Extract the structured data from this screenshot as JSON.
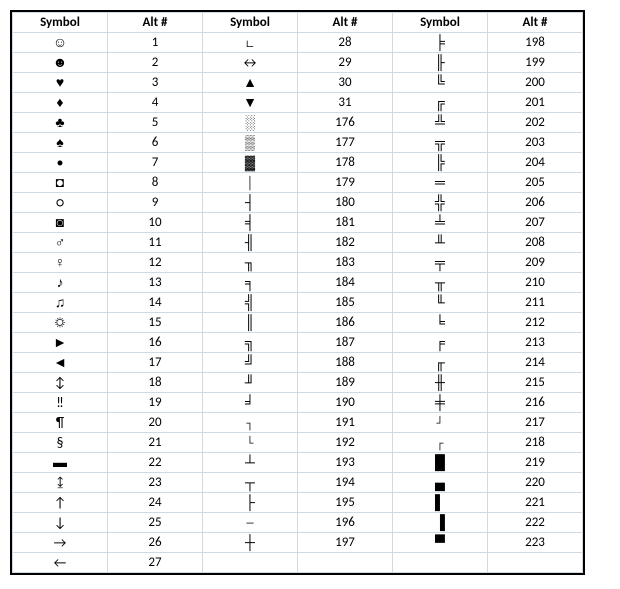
{
  "headers": [
    "Symbol",
    "Alt #",
    "Symbol",
    "Alt #",
    "Symbol",
    "Alt #"
  ],
  "chart_data": {
    "type": "table",
    "title": "Alt Code Symbol Reference",
    "columns": [
      "Symbol",
      "Alt #",
      "Symbol",
      "Alt #",
      "Symbol",
      "Alt #"
    ],
    "rows": [
      [
        "☺",
        "1",
        "∟",
        "28",
        "╞",
        "198"
      ],
      [
        "☻",
        "2",
        "↔",
        "29",
        "╟",
        "199"
      ],
      [
        "♥",
        "3",
        "▲",
        "30",
        "╚",
        "200"
      ],
      [
        "♦",
        "4",
        "▼",
        "31",
        "╔",
        "201"
      ],
      [
        "♣",
        "5",
        "░",
        "176",
        "╩",
        "202"
      ],
      [
        "♠",
        "6",
        "▒",
        "177",
        "╦",
        "203"
      ],
      [
        "•",
        "7",
        "▓",
        "178",
        "╠",
        "204"
      ],
      [
        "◘",
        "8",
        "│",
        "179",
        "═",
        "205"
      ],
      [
        "○",
        "9",
        "┤",
        "180",
        "╬",
        "206"
      ],
      [
        "◙",
        "10",
        "╡",
        "181",
        "╧",
        "207"
      ],
      [
        "♂",
        "11",
        "╢",
        "182",
        "╨",
        "208"
      ],
      [
        "♀",
        "12",
        "╖",
        "183",
        "╤",
        "209"
      ],
      [
        "♪",
        "13",
        "╕",
        "184",
        "╥",
        "210"
      ],
      [
        "♫",
        "14",
        "╣",
        "185",
        "╙",
        "211"
      ],
      [
        "☼",
        "15",
        "║",
        "186",
        "╘",
        "212"
      ],
      [
        "►",
        "16",
        "╗",
        "187",
        "╒",
        "213"
      ],
      [
        "◄",
        "17",
        "╝",
        "188",
        "╓",
        "214"
      ],
      [
        "↕",
        "18",
        "╜",
        "189",
        "╫",
        "215"
      ],
      [
        "‼",
        "19",
        "╛",
        "190",
        "╪",
        "216"
      ],
      [
        "¶",
        "20",
        "┐",
        "191",
        "┘",
        "217"
      ],
      [
        "§",
        "21",
        "└",
        "192",
        "┌",
        "218"
      ],
      [
        "▬",
        "22",
        "┴",
        "193",
        "█",
        "219"
      ],
      [
        "↨",
        "23",
        "┬",
        "194",
        "▄",
        "220"
      ],
      [
        "↑",
        "24",
        "├",
        "195",
        "▌",
        "221"
      ],
      [
        "↓",
        "25",
        "─",
        "196",
        "▐",
        "222"
      ],
      [
        "→",
        "26",
        "┼",
        "197",
        "▀",
        "223"
      ],
      [
        "←",
        "27",
        "",
        "",
        "",
        ""
      ]
    ]
  }
}
